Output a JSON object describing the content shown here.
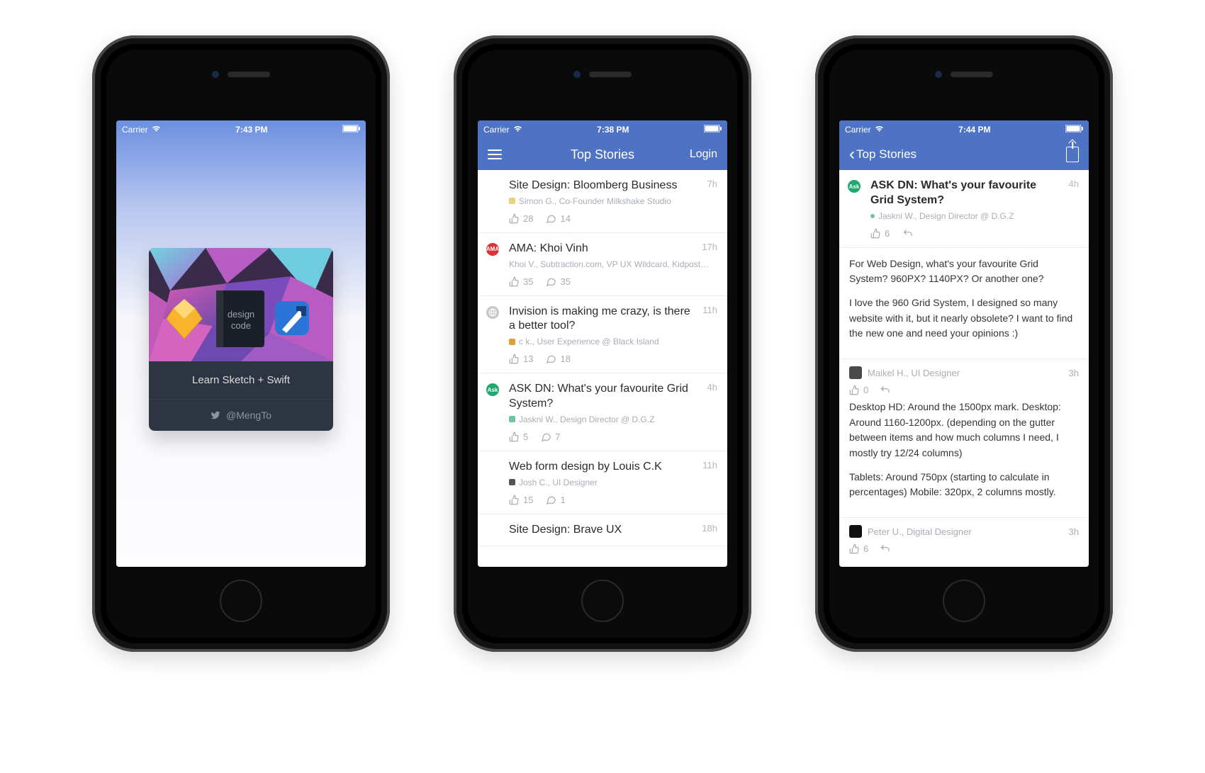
{
  "screen1": {
    "status": {
      "carrier": "Carrier",
      "time": "7:43 PM"
    },
    "card": {
      "title_line1": "design",
      "title_line2": "code",
      "mid": "Learn Sketch + Swift",
      "handle": "@MengTo"
    }
  },
  "screen2": {
    "status": {
      "carrier": "Carrier",
      "time": "7:38 PM"
    },
    "nav": {
      "title": "Top Stories",
      "login": "Login"
    },
    "stories": [
      {
        "title": "Site Design: Bloomberg Business",
        "time": "7h",
        "author": "Simon G., Co-Founder Milkshake Studio",
        "authorColor": "#e8d27a",
        "likes": "28",
        "comments": "14",
        "badge": null
      },
      {
        "title": "AMA: Khoi Vinh",
        "time": "17h",
        "author": "Khoi V., Subtraction.com, VP UX Wildcard, Kidpost…",
        "authorColor": null,
        "likes": "35",
        "comments": "35",
        "badge": "ama",
        "badgeText": "AMA"
      },
      {
        "title": "Invision is making me crazy, is there a better tool?",
        "time": "11h",
        "author": "c k., User Experience @ Black Island",
        "authorColor": "#e0a035",
        "likes": "13",
        "comments": "18",
        "badge": "globe",
        "badgeText": ""
      },
      {
        "title": "ASK DN: What's your favourite Grid System?",
        "time": "4h",
        "author": "Jaskni W., Design Director @ D.G.Z",
        "authorColor": "#6cc7a0",
        "likes": "5",
        "comments": "7",
        "badge": "ask",
        "badgeText": "Ask"
      },
      {
        "title": "Web form design by Louis C.K",
        "time": "11h",
        "author": "Josh C., UI Designer",
        "authorColor": "#555",
        "likes": "15",
        "comments": "1",
        "badge": null
      },
      {
        "title": "Site Design: Brave UX",
        "time": "18h",
        "author": "",
        "authorColor": null,
        "likes": "",
        "comments": "",
        "badge": null
      }
    ]
  },
  "screen3": {
    "status": {
      "carrier": "Carrier",
      "time": "7:44 PM"
    },
    "nav": {
      "back": "Top Stories"
    },
    "thread": {
      "badge": "ask",
      "badgeText": "Ask",
      "title": "ASK DN: What's your favourite Grid System?",
      "time": "4h",
      "author": "Jaskni W., Design Director @ D.G.Z",
      "authorColor": "#6cc7a0",
      "likes": "6",
      "body_p1": "For Web Design, what's your favourite Grid System? 960PX? 1140PX? Or another one?",
      "body_p2": "I love the 960 Grid System, I designed so many website with it, but it nearly obsolete? I want to find the new one and need your opinions :)"
    },
    "comments": [
      {
        "author": "Maikel H., UI Designer",
        "time": "3h",
        "likes": "0",
        "body_p1": "Desktop HD: Around the 1500px mark. Desktop: Around 1160-1200px. (depending on the gutter between items and how much columns I need, I mostly try 12/24 columns)",
        "body_p2": "Tablets: Around 750px (starting to calculate in percentages) Mobile: 320px, 2 columns mostly.",
        "avatarColor": "#4a4a4a"
      },
      {
        "author": "Peter U., Digital Designer",
        "time": "3h",
        "likes": "6",
        "body_p1": "",
        "body_p2": "",
        "avatarColor": "#111"
      }
    ]
  }
}
